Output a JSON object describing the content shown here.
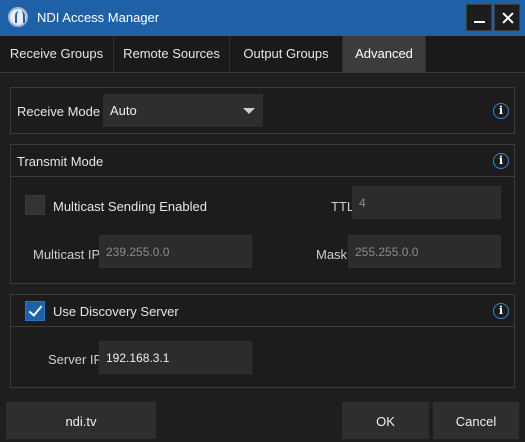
{
  "window": {
    "title": "NDI Access Manager"
  },
  "tabs": [
    {
      "label": "Receive Groups",
      "active": false
    },
    {
      "label": "Remote Sources",
      "active": false
    },
    {
      "label": "Output Groups",
      "active": false
    },
    {
      "label": "Advanced",
      "active": true
    }
  ],
  "receive_mode": {
    "label": "Receive Mode",
    "value": "Auto"
  },
  "transmit_mode": {
    "heading": "Transmit Mode",
    "multicast_enabled_label": "Multicast Sending Enabled",
    "multicast_enabled": false,
    "ttl_label": "TTL",
    "ttl_placeholder": "4",
    "multicast_ip_label": "Multicast IP",
    "multicast_ip_placeholder": "239.255.0.0",
    "mask_label": "Mask",
    "mask_placeholder": "255.255.0.0"
  },
  "discovery": {
    "use_label": "Use Discovery Server",
    "enabled": true,
    "server_ip_label": "Server IP",
    "server_ip_value": "192.168.3.1"
  },
  "buttons": {
    "website": "ndi.tv",
    "ok": "OK",
    "cancel": "Cancel"
  },
  "icons": {
    "info": "i"
  },
  "colors": {
    "accent": "#1f61a8",
    "info_ring": "#3b86dd"
  }
}
